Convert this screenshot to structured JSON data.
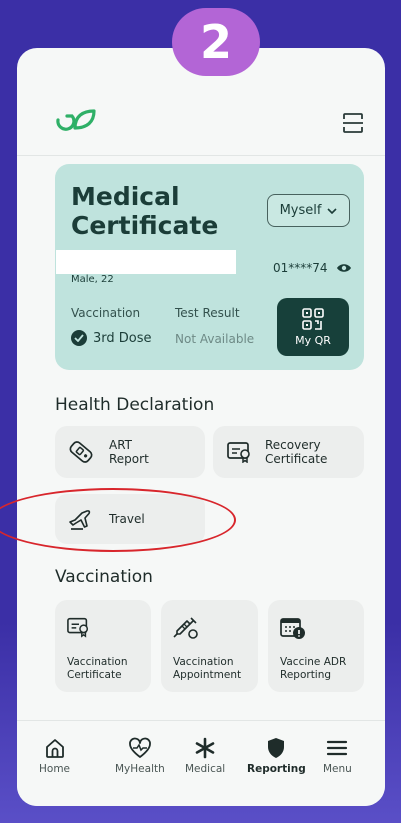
{
  "step_badge": "2",
  "header": {
    "logo_icon": "leaf-logo-icon",
    "scan_icon": "scan-icon"
  },
  "medical_certificate": {
    "title": "Medical Certificate",
    "profile_selector": "Myself",
    "gender_age": "Male, 22",
    "id_masked": "01****74",
    "vaccination_label": "Vaccination",
    "vaccination_value": "3rd Dose",
    "test_result_label": "Test Result",
    "test_result_value": "Not Available",
    "qr_button": "My QR"
  },
  "health_declaration": {
    "title": "Health Declaration",
    "items": [
      {
        "label_line1": "ART",
        "label_line2": "Report",
        "icon": "test-kit-icon"
      },
      {
        "label_line1": "Recovery",
        "label_line2": "Certificate",
        "icon": "certificate-icon"
      },
      {
        "label_line1": "Travel",
        "label_line2": "",
        "icon": "plane-icon"
      }
    ]
  },
  "vaccination": {
    "title": "Vaccination",
    "items": [
      {
        "label_line1": "Vaccination",
        "label_line2": "Certificate",
        "icon": "certificate-icon"
      },
      {
        "label_line1": "Vaccination",
        "label_line2": "Appointment",
        "icon": "syringe-icon"
      },
      {
        "label_line1": "Vaccine ADR",
        "label_line2": "Reporting",
        "icon": "calendar-alert-icon"
      }
    ]
  },
  "bottom_nav": {
    "items": [
      {
        "label": "Home",
        "icon": "home-icon"
      },
      {
        "label": "MyHealth",
        "icon": "heart-pulse-icon"
      },
      {
        "label": "Medical",
        "icon": "asterisk-icon"
      },
      {
        "label": "Reporting",
        "icon": "shield-icon",
        "active": true
      },
      {
        "label": "Menu",
        "icon": "hamburger-icon"
      }
    ]
  },
  "colors": {
    "background": "#3b2fa6",
    "badge": "#b365d6",
    "card": "#bfe3dd",
    "qr_button": "#17403a",
    "annotation": "#d8262c"
  }
}
